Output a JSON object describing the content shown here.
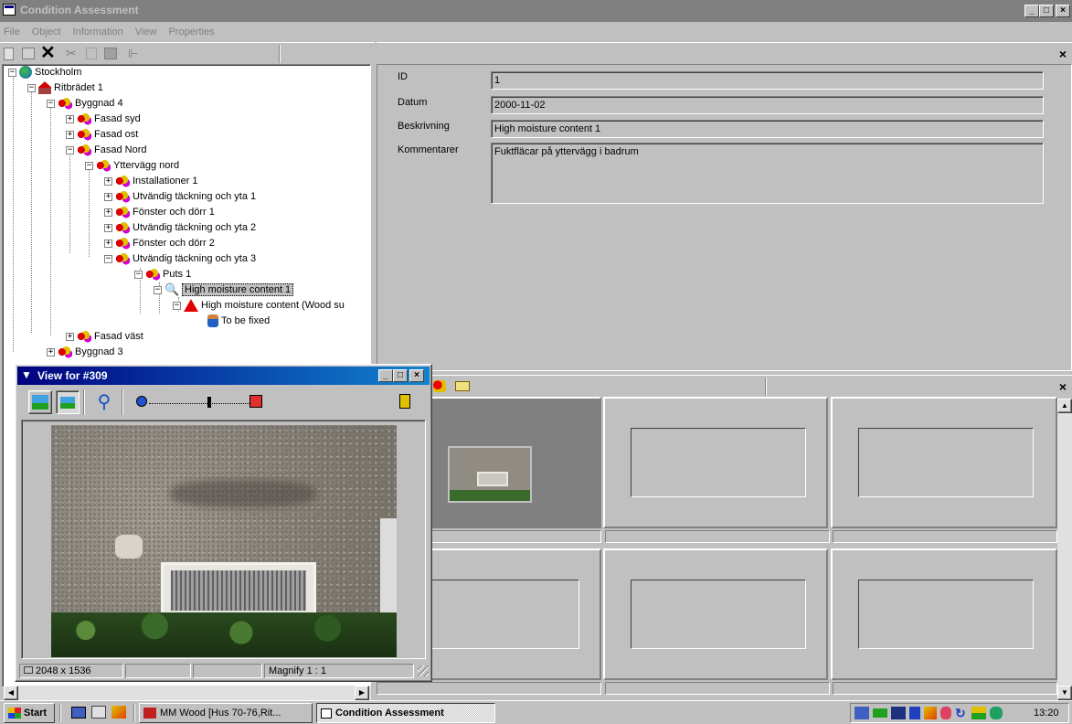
{
  "window": {
    "title": "Condition Assessment"
  },
  "menu": [
    "File",
    "Object",
    "Information",
    "View",
    "Properties"
  ],
  "tree": [
    {
      "label": "Stockholm",
      "icon": "globe-icon"
    },
    {
      "label": "Ritbrädet 1",
      "icon": "house-icon"
    },
    {
      "label": "Byggnad 4",
      "icon": "component-icon"
    },
    {
      "label": "Fasad syd",
      "icon": "component-icon"
    },
    {
      "label": "Fasad ost",
      "icon": "component-icon"
    },
    {
      "label": "Fasad Nord",
      "icon": "component-icon"
    },
    {
      "label": "Yttervägg nord",
      "icon": "component-icon"
    },
    {
      "label": "Installationer 1",
      "icon": "component-icon"
    },
    {
      "label": "Utvändig täckning och yta 1",
      "icon": "component-icon"
    },
    {
      "label": "Fönster och dörr 1",
      "icon": "component-icon"
    },
    {
      "label": "Utvändig täckning och yta 2",
      "icon": "component-icon"
    },
    {
      "label": "Fönster och dörr 2",
      "icon": "component-icon"
    },
    {
      "label": "Utvändig täckning och yta 3",
      "icon": "component-icon"
    },
    {
      "label": "Puts 1",
      "icon": "component-icon"
    },
    {
      "label": "High moisture content 1",
      "icon": "magnifier-icon"
    },
    {
      "label": "High moisture content (Wood su",
      "icon": "warning-icon"
    },
    {
      "label": "To be fixed",
      "icon": "worker-icon"
    },
    {
      "label": "Fasad väst",
      "icon": "component-icon"
    },
    {
      "label": "Byggnad 3",
      "icon": "component-icon"
    }
  ],
  "details": {
    "id_label": "ID",
    "id_value": "1",
    "datum_label": "Datum",
    "datum_value": "2000-11-02",
    "beskrivning_label": "Beskrivning",
    "beskrivning_value": "High moisture content 1",
    "kommentarer_label": "Kommentarer",
    "kommentarer_value": "Fuktfläcar på yttervägg i badrum"
  },
  "close_glyph": "×",
  "viewer": {
    "title": "View for #309",
    "size": "2048 x 1536",
    "magnify": "Magnify 1 : 1"
  },
  "taskbar": {
    "start": "Start",
    "task1": "MM Wood  [Hus 70-76,Rit...",
    "task2": "Condition Assessment",
    "clock": "13:20"
  },
  "colors": {
    "title_active": "#000080",
    "title_inactive": "#808080",
    "desktop_face": "#c0c0c0"
  }
}
